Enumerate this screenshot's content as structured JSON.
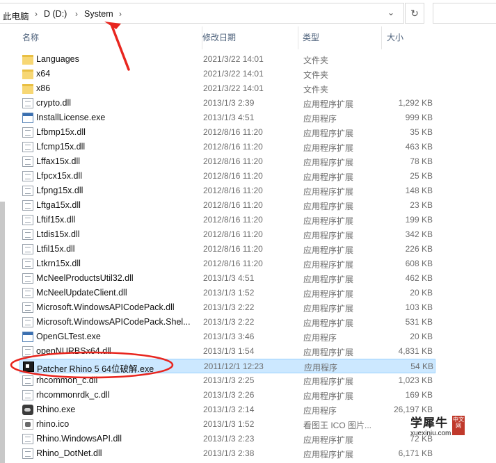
{
  "address_bar": {
    "crumbs": [
      "此电脑",
      "D (D:)",
      "System"
    ],
    "separator": "›",
    "dropdown_glyph": "⌄",
    "refresh_glyph": "↻"
  },
  "columns": {
    "name": "名称",
    "modified": "修改日期",
    "type": "类型",
    "size": "大小"
  },
  "files": [
    {
      "icon": "folder-icon",
      "name": "Languages",
      "modified": "2021/3/22 14:01",
      "type": "文件夹",
      "size": ""
    },
    {
      "icon": "folder-icon",
      "name": "x64",
      "modified": "2021/3/22 14:01",
      "type": "文件夹",
      "size": ""
    },
    {
      "icon": "folder-icon",
      "name": "x86",
      "modified": "2021/3/22 14:01",
      "type": "文件夹",
      "size": ""
    },
    {
      "icon": "dll-icon",
      "name": "crypto.dll",
      "modified": "2013/1/3 2:39",
      "type": "应用程序扩展",
      "size": "1,292 KB"
    },
    {
      "icon": "exe-icon",
      "name": "InstallLicense.exe",
      "modified": "2013/1/3 4:51",
      "type": "应用程序",
      "size": "999 KB"
    },
    {
      "icon": "dll-icon",
      "name": "Lfbmp15x.dll",
      "modified": "2012/8/16 11:20",
      "type": "应用程序扩展",
      "size": "35 KB"
    },
    {
      "icon": "dll-icon",
      "name": "Lfcmp15x.dll",
      "modified": "2012/8/16 11:20",
      "type": "应用程序扩展",
      "size": "463 KB"
    },
    {
      "icon": "dll-icon",
      "name": "Lffax15x.dll",
      "modified": "2012/8/16 11:20",
      "type": "应用程序扩展",
      "size": "78 KB"
    },
    {
      "icon": "dll-icon",
      "name": "Lfpcx15x.dll",
      "modified": "2012/8/16 11:20",
      "type": "应用程序扩展",
      "size": "25 KB"
    },
    {
      "icon": "dll-icon",
      "name": "Lfpng15x.dll",
      "modified": "2012/8/16 11:20",
      "type": "应用程序扩展",
      "size": "148 KB"
    },
    {
      "icon": "dll-icon",
      "name": "Lftga15x.dll",
      "modified": "2012/8/16 11:20",
      "type": "应用程序扩展",
      "size": "23 KB"
    },
    {
      "icon": "dll-icon",
      "name": "Lftif15x.dll",
      "modified": "2012/8/16 11:20",
      "type": "应用程序扩展",
      "size": "199 KB"
    },
    {
      "icon": "dll-icon",
      "name": "Ltdis15x.dll",
      "modified": "2012/8/16 11:20",
      "type": "应用程序扩展",
      "size": "342 KB"
    },
    {
      "icon": "dll-icon",
      "name": "Ltfil15x.dll",
      "modified": "2012/8/16 11:20",
      "type": "应用程序扩展",
      "size": "226 KB"
    },
    {
      "icon": "dll-icon",
      "name": "Ltkrn15x.dll",
      "modified": "2012/8/16 11:20",
      "type": "应用程序扩展",
      "size": "608 KB"
    },
    {
      "icon": "dll-icon",
      "name": "McNeelProductsUtil32.dll",
      "modified": "2013/1/3 4:51",
      "type": "应用程序扩展",
      "size": "462 KB"
    },
    {
      "icon": "dll-icon",
      "name": "McNeelUpdateClient.dll",
      "modified": "2013/1/3 1:52",
      "type": "应用程序扩展",
      "size": "20 KB"
    },
    {
      "icon": "dll-icon",
      "name": "Microsoft.WindowsAPICodePack.dll",
      "modified": "2013/1/3 2:22",
      "type": "应用程序扩展",
      "size": "103 KB"
    },
    {
      "icon": "dll-icon",
      "name": "Microsoft.WindowsAPICodePack.Shel...",
      "modified": "2013/1/3 2:22",
      "type": "应用程序扩展",
      "size": "531 KB"
    },
    {
      "icon": "exe-icon",
      "name": "OpenGLTest.exe",
      "modified": "2013/1/3 3:46",
      "type": "应用程序",
      "size": "20 KB"
    },
    {
      "icon": "dll-icon",
      "name": "openNURBSx64.dll",
      "modified": "2013/1/3 1:54",
      "type": "应用程序扩展",
      "size": "4,831 KB"
    },
    {
      "icon": "app-black-icon",
      "name": "Patcher Rhino 5 64位破解.exe",
      "modified": "2011/12/1 12:23",
      "type": "应用程序",
      "size": "54 KB",
      "selected": true
    },
    {
      "icon": "dll-icon",
      "name": "rhcommon_c.dll",
      "modified": "2013/1/3 2:25",
      "type": "应用程序扩展",
      "size": "1,023 KB"
    },
    {
      "icon": "dll-icon",
      "name": "rhcommonrdk_c.dll",
      "modified": "2013/1/3 2:26",
      "type": "应用程序扩展",
      "size": "169 KB"
    },
    {
      "icon": "rhino-icon",
      "name": "Rhino.exe",
      "modified": "2013/1/3 2:14",
      "type": "应用程序",
      "size": "26,197 KB"
    },
    {
      "icon": "ico-file-icon",
      "name": "rhino.ico",
      "modified": "2013/1/3 1:52",
      "type": "看图王 ICO 图片...",
      "size": "3"
    },
    {
      "icon": "dll-icon",
      "name": "Rhino.WindowsAPI.dll",
      "modified": "2013/1/3 2:23",
      "type": "应用程序扩展",
      "size": "72 KB"
    },
    {
      "icon": "dll-icon",
      "name": "Rhino_DotNet.dll",
      "modified": "2013/1/3 2:38",
      "type": "应用程序扩展",
      "size": "6,171 KB"
    }
  ],
  "watermark": {
    "title": "学犀牛",
    "badge": "中文网",
    "url": "xuexiniu.com"
  },
  "colors": {
    "annotation_red": "#e8261f",
    "selection_bg": "#cce8ff",
    "selection_border": "#99d1ff"
  }
}
